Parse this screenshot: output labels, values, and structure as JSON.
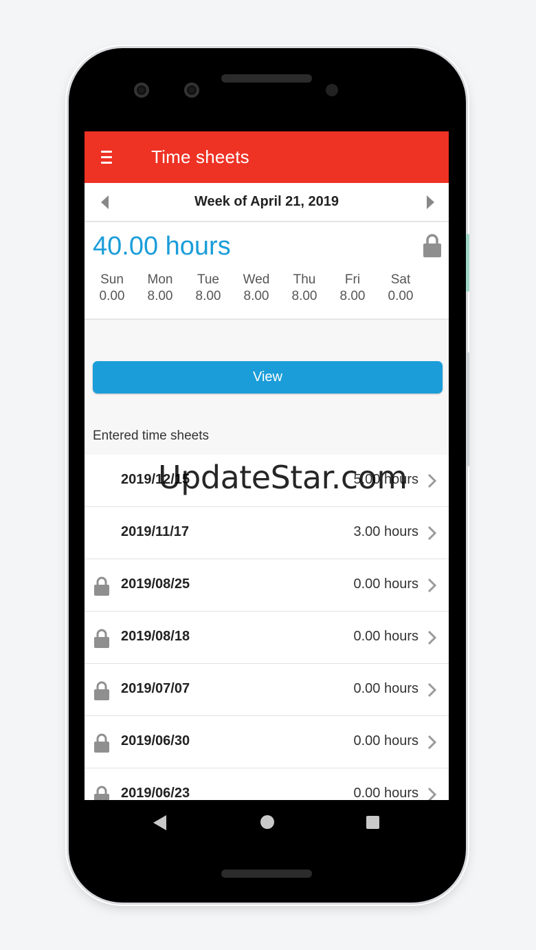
{
  "app": {
    "title": "Time sheets"
  },
  "week": {
    "label": "Week of April 21, 2019"
  },
  "summary": {
    "total": "40.00 hours",
    "locked": true,
    "days": [
      {
        "name": "Sun",
        "hours": "0.00"
      },
      {
        "name": "Mon",
        "hours": "8.00"
      },
      {
        "name": "Tue",
        "hours": "8.00"
      },
      {
        "name": "Wed",
        "hours": "8.00"
      },
      {
        "name": "Thu",
        "hours": "8.00"
      },
      {
        "name": "Fri",
        "hours": "8.00"
      },
      {
        "name": "Sat",
        "hours": "0.00"
      }
    ]
  },
  "actions": {
    "view_label": "View"
  },
  "entered": {
    "label": "Entered time sheets",
    "items": [
      {
        "date": "2019/12/15",
        "hours": "5.00 hours",
        "locked": false
      },
      {
        "date": "2019/11/17",
        "hours": "3.00 hours",
        "locked": false
      },
      {
        "date": "2019/08/25",
        "hours": "0.00 hours",
        "locked": true
      },
      {
        "date": "2019/08/18",
        "hours": "0.00 hours",
        "locked": true
      },
      {
        "date": "2019/07/07",
        "hours": "0.00 hours",
        "locked": true
      },
      {
        "date": "2019/06/30",
        "hours": "0.00 hours",
        "locked": true
      },
      {
        "date": "2019/06/23",
        "hours": "0.00 hours",
        "locked": true
      }
    ]
  },
  "watermark": "UpdateStar.com",
  "colors": {
    "appbar": "#ee3224",
    "accent": "#1a9dd9",
    "icon_gray": "#8f8f8f"
  },
  "icons": {
    "menu": "hamburger-icon",
    "prev": "chevron-left-icon",
    "next": "chevron-right-icon",
    "lock": "lock-icon",
    "row_chevron": "chevron-right-icon"
  }
}
